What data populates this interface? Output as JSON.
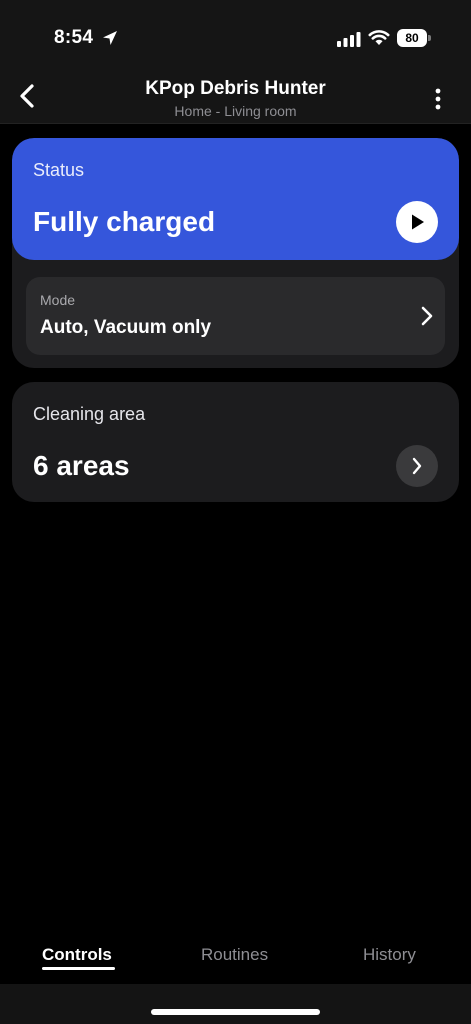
{
  "status_bar": {
    "time": "8:54",
    "battery": "80"
  },
  "header": {
    "title": "KPop Debris Hunter",
    "subtitle": "Home - Living room"
  },
  "status_card": {
    "label": "Status",
    "value": "Fully charged",
    "accent_color": "#3556db"
  },
  "mode": {
    "label": "Mode",
    "value": "Auto, Vacuum only"
  },
  "cleaning_area": {
    "label": "Cleaning area",
    "value": "6 areas"
  },
  "tabs": [
    {
      "label": "Controls",
      "active": true
    },
    {
      "label": "Routines",
      "active": false
    },
    {
      "label": "History",
      "active": false
    }
  ],
  "icons": [
    "location-arrow-icon",
    "signal-icon",
    "wifi-icon",
    "battery-icon",
    "back-arrow-icon",
    "more-vertical-icon",
    "play-icon",
    "chevron-right-icon"
  ]
}
